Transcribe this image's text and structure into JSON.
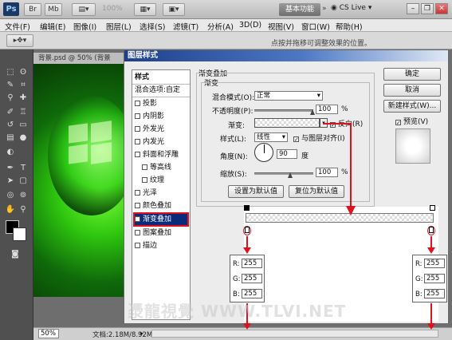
{
  "app": {
    "logo": "Ps",
    "zoom": "100%",
    "workspace": "基本功能",
    "cslive": "CS Live"
  },
  "menubar": [
    "文件(F)",
    "编辑(E)",
    "图像(I)",
    "图层(L)",
    "选择(S)",
    "滤镜(T)",
    "分析(A)",
    "3D(D)",
    "视图(V)",
    "窗口(W)",
    "帮助(H)"
  ],
  "options_hint": "点按并拖移可调整效果的位置。",
  "document": {
    "tab_title": "背景.psd @ 50% (背景",
    "zoom": "50%",
    "doc_info": "文档:2.18M/8.92M"
  },
  "dialog": {
    "title": "图层样式",
    "styles_header": "样式",
    "blend_options": "混合选项:自定",
    "styles": [
      "投影",
      "内阴影",
      "外发光",
      "内发光",
      "斜面和浮雕",
      "等高线",
      "纹理",
      "光泽",
      "颜色叠加",
      "渐变叠加",
      "图案叠加",
      "描边"
    ],
    "active_style": "渐变叠加",
    "group_title": "渐变叠加",
    "sub_title": "渐变",
    "blend_mode_label": "混合模式(O):",
    "blend_mode_value": "正常",
    "opacity_label": "不透明度(P):",
    "opacity_value": "100",
    "percent": "%",
    "gradient_label": "渐变:",
    "reverse_label": "反向(R)",
    "style_label": "样式(L):",
    "style_value": "线性",
    "align_label": "与图层对齐(I)",
    "angle_label": "角度(N):",
    "angle_value": "90",
    "degree": "度",
    "scale_label": "缩放(S):",
    "scale_value": "100",
    "set_default": "设置为默认值",
    "reset_default": "复位为默认值",
    "ok": "确定",
    "cancel": "取消",
    "new_style": "新建样式(W)...",
    "preview": "预览(V)"
  },
  "color_left": {
    "r_label": "R:",
    "g_label": "G:",
    "b_label": "B:",
    "r": "255",
    "g": "255",
    "b": "255"
  },
  "color_right": {
    "r_label": "R:",
    "g_label": "G:",
    "b_label": "B:",
    "r": "255",
    "g": "255",
    "b": "255"
  },
  "watermark": "㵗龍視覺 WWW.TLVI.NET",
  "colors": {
    "accent_red": "#e0101c",
    "title_blue": "#1e3f8c",
    "canvas_green": "#2fc70f"
  }
}
